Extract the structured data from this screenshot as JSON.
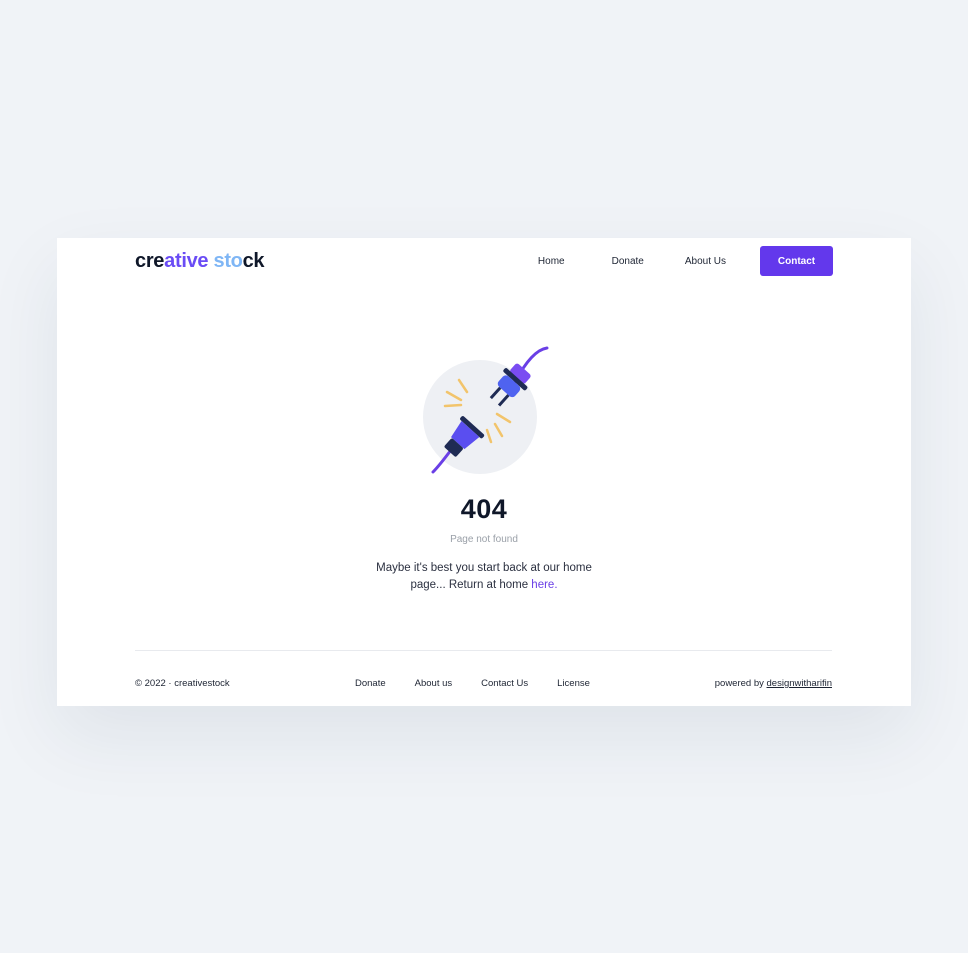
{
  "header": {
    "logo_part1": "cre",
    "logo_part2": "ative",
    "logo_part3": " ",
    "logo_part4": "sto",
    "logo_part5": "ck",
    "nav": {
      "home": "Home",
      "donate": "Donate",
      "about": "About Us",
      "contact": "Contact"
    }
  },
  "error": {
    "illustration": "unplugged-plug-icon",
    "code": "404",
    "subtitle": "Page not found",
    "message_line1": "Maybe it's best you start back at our home",
    "message_line2": "page... Return at home ",
    "link_text": "here."
  },
  "footer": {
    "copyright": "© 2022 · creativestock",
    "links": [
      "Donate",
      "About us",
      "Contact Us",
      "License"
    ],
    "powered_prefix": "powered by ",
    "powered_link": "designwitharifin"
  },
  "colors": {
    "accent": "#6338ec",
    "page_background": "#f0f3f7",
    "card_background": "#ffffff",
    "spark": "#f2c46b"
  }
}
